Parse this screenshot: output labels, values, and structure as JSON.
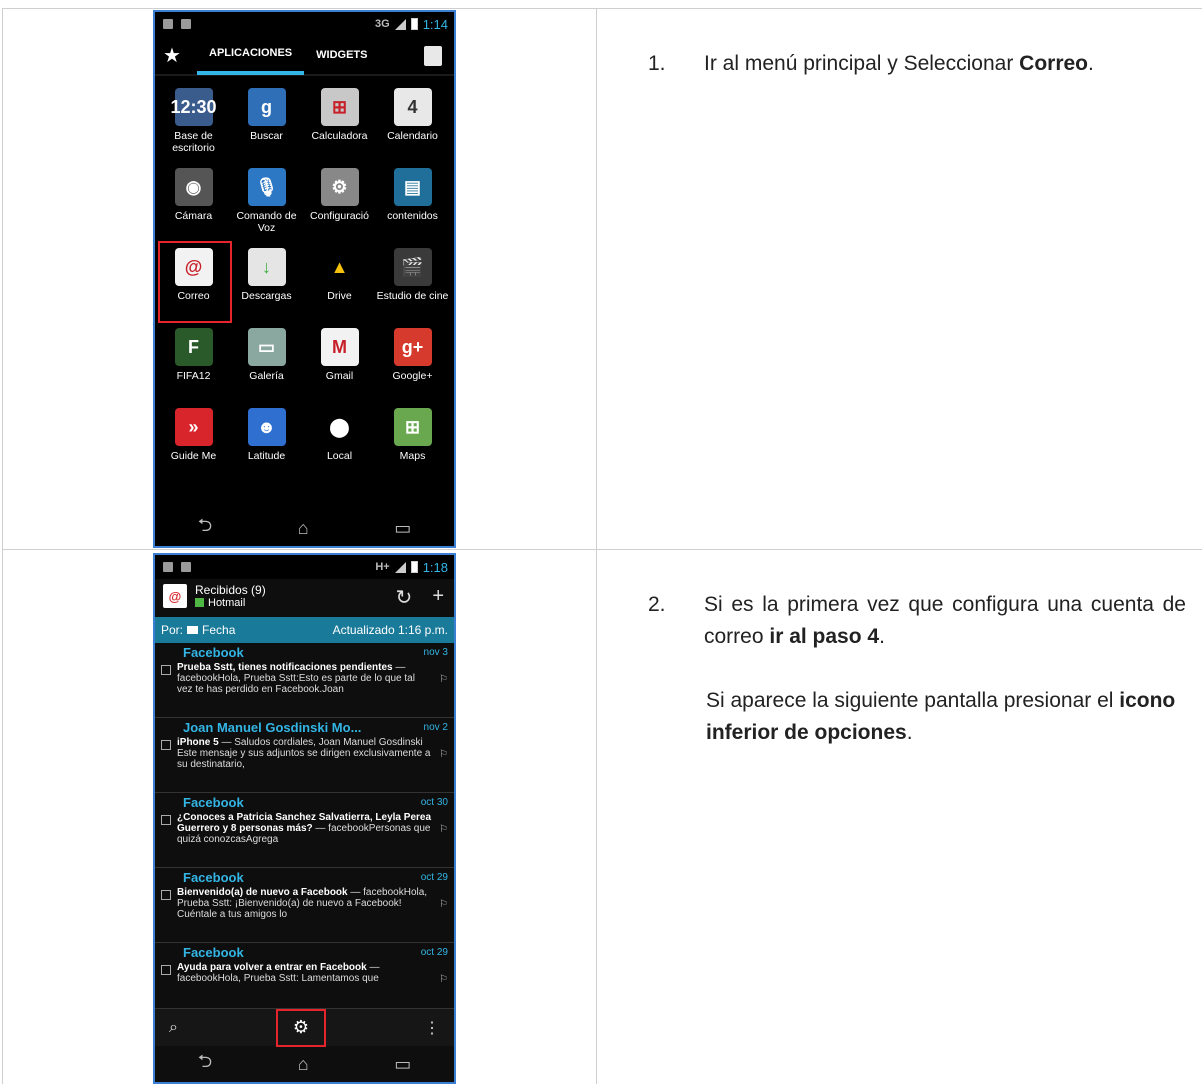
{
  "phone1": {
    "status": {
      "network": "3G",
      "time": "1:14"
    },
    "tabs": {
      "apps": "APLICACIONES",
      "widgets": "WIDGETS"
    },
    "apps": [
      {
        "label": "Base de escritorio",
        "icon": "desk-clock-icon",
        "color": "#3a5c8c",
        "glyph": "12:30"
      },
      {
        "label": "Buscar",
        "icon": "google-search-icon",
        "color": "#2f6fb8",
        "glyph": "g"
      },
      {
        "label": "Calculadora",
        "icon": "calculator-icon",
        "color": "#c8c8c8",
        "glyph": "⊞"
      },
      {
        "label": "Calendario",
        "icon": "calendar-icon",
        "color": "#e8e8e8",
        "glyph": "4"
      },
      {
        "label": "Cámara",
        "icon": "camera-icon",
        "color": "#555555",
        "glyph": "◉"
      },
      {
        "label": "Comando de Voz",
        "icon": "voice-command-icon",
        "color": "#2d78c4",
        "glyph": "🎙"
      },
      {
        "label": "Configuració",
        "icon": "settings-icon",
        "color": "#888888",
        "glyph": "⚙"
      },
      {
        "label": "contenidos",
        "icon": "content-icon",
        "color": "#1f6f9a",
        "glyph": "▤"
      },
      {
        "label": "Correo",
        "icon": "email-icon",
        "color": "#f2f2f2",
        "glyph": "@"
      },
      {
        "label": "Descargas",
        "icon": "download-icon",
        "color": "#e5e5e5",
        "glyph": "↓"
      },
      {
        "label": "Drive",
        "icon": "drive-icon",
        "color": "#000000",
        "glyph": "▲"
      },
      {
        "label": "Estudio de cine",
        "icon": "movie-studio-icon",
        "color": "#3a3a3a",
        "glyph": "🎬"
      },
      {
        "label": "FIFA12",
        "icon": "fifa-icon",
        "color": "#2a5a2a",
        "glyph": "F"
      },
      {
        "label": "Galería",
        "icon": "gallery-icon",
        "color": "#8aa8a0",
        "glyph": "▭"
      },
      {
        "label": "Gmail",
        "icon": "gmail-icon",
        "color": "#f2f2f2",
        "glyph": "M"
      },
      {
        "label": "Google+",
        "icon": "google-plus-icon",
        "color": "#d53a2c",
        "glyph": "g+"
      },
      {
        "label": "Guide Me",
        "icon": "guide-me-icon",
        "color": "#d8252b",
        "glyph": "»"
      },
      {
        "label": "Latitude",
        "icon": "latitude-icon",
        "color": "#2f6fd0",
        "glyph": "☻"
      },
      {
        "label": "Local",
        "icon": "local-pin-icon",
        "color": "#000000",
        "glyph": "⬤"
      },
      {
        "label": "Maps",
        "icon": "maps-icon",
        "color": "#6aa84f",
        "glyph": "⊞"
      }
    ]
  },
  "phone2": {
    "status": {
      "network": "H+",
      "time": "1:18"
    },
    "header": {
      "title": "Recibidos (9)",
      "account": "Hotmail"
    },
    "sort": {
      "by": "Por:",
      "field": "Fecha",
      "updated": "Actualizado 1:16 p.m."
    },
    "messages": [
      {
        "sender": "Facebook",
        "date": "nov 3",
        "subject": "Prueba Sstt, tienes notificaciones pendientes",
        "preview": "— facebookHola, Prueba Sstt:Esto es parte de lo que tal vez te has perdido en Facebook.Joan"
      },
      {
        "sender": "Joan Manuel Gosdinski Mo...",
        "date": "nov 2",
        "subject": "iPhone 5",
        "preview": "— Saludos cordiales, Joan Manuel Gosdinski Este mensaje y sus adjuntos se dirigen exclusivamente a su destinatario,"
      },
      {
        "sender": "Facebook",
        "date": "oct 30",
        "subject": "¿Conoces a Patricia Sanchez Salvatierra, Leyla Perea Guerrero y 8 personas más?",
        "preview": "— facebookPersonas que quizá conozcasAgrega"
      },
      {
        "sender": "Facebook",
        "date": "oct 29",
        "subject": "Bienvenido(a) de nuevo a Facebook",
        "preview": "— facebookHola, Prueba Sstt: ¡Bienvenido(a) de nuevo a Facebook! Cuéntale a tus amigos lo"
      },
      {
        "sender": "Facebook",
        "date": "oct 29",
        "subject": "Ayuda para volver a entrar en Facebook",
        "preview": "— facebookHola, Prueba Sstt: Lamentamos que"
      }
    ]
  },
  "steps": {
    "s1": {
      "num": "1.",
      "text": "Ir al menú principal y Seleccionar ",
      "bold": "Correo",
      "end": "."
    },
    "s2": {
      "num": "2.",
      "text": "Si es la primera vez que configura una cuenta de correo ",
      "bold": "ir al paso 4",
      "end": ".",
      "p2_text": "Si aparece la siguiente pantalla presionar el ",
      "p2_bold": "icono inferior de opciones",
      "p2_end": "."
    }
  }
}
